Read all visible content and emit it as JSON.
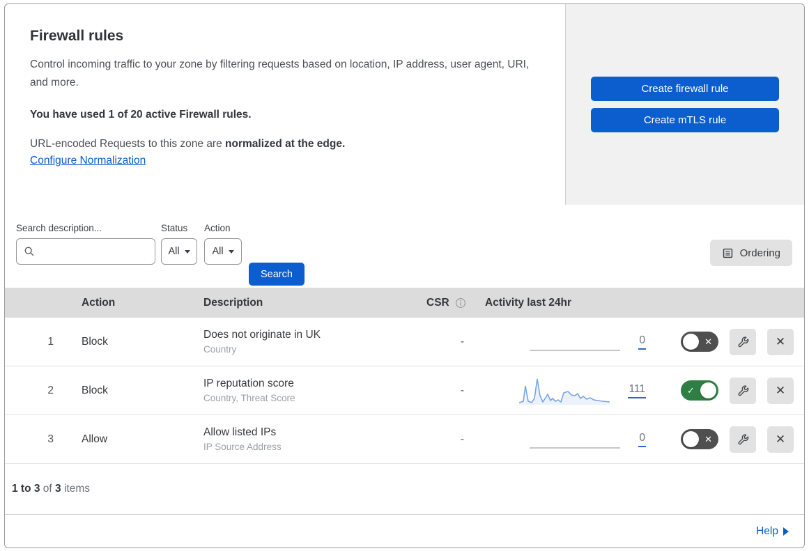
{
  "colors": {
    "accent_blue": "#0c5dce",
    "link_blue": "#0b5cc9",
    "toggle_on_green": "#2d7f43",
    "toggle_off_gray": "#4f4f4f",
    "sparkline_blue": "#7aa5e3",
    "table_header_gray": "#dcdcdc",
    "panel_gray": "#f1f1f2"
  },
  "header": {
    "title": "Firewall rules",
    "description": "Control incoming traffic to your zone by filtering requests based on location, IP address, user agent, URI, and more.",
    "usage_note": "You have used 1 of 20 active Firewall rules.",
    "normalization_prefix": "URL-encoded Requests to this zone are ",
    "normalization_bold": "normalized at the edge.",
    "normalization_link": "Configure Normalization"
  },
  "actions_panel": {
    "create_firewall_rule_label": "Create firewall rule",
    "create_mtls_rule_label": "Create mTLS rule"
  },
  "filters": {
    "search_label": "Search description...",
    "status_label": "Status",
    "status_value": "All",
    "action_label": "Action",
    "action_value": "All",
    "search_button_label": "Search",
    "ordering_button_label": "Ordering"
  },
  "table": {
    "columns": {
      "action": "Action",
      "description": "Description",
      "csr": "CSR",
      "activity": "Activity last 24hr"
    },
    "rows": [
      {
        "number": "1",
        "action": "Block",
        "description": "Does not originate in UK",
        "fields": "Country",
        "csr": "-",
        "activity_count": "0",
        "enabled": false,
        "has_activity": false
      },
      {
        "number": "2",
        "action": "Block",
        "description": "IP reputation score",
        "fields": "Country, Threat Score",
        "csr": "-",
        "activity_count": "111",
        "enabled": true,
        "has_activity": true
      },
      {
        "number": "3",
        "action": "Allow",
        "description": "Allow listed IPs",
        "fields": "IP Source Address",
        "csr": "-",
        "activity_count": "0",
        "enabled": false,
        "has_activity": false
      }
    ]
  },
  "icons": {
    "toggle_on_glyph": "✓",
    "toggle_off_glyph": "✕",
    "close_glyph": "✕"
  },
  "footer": {
    "range_bold": "1 to 3",
    "of_text": " of ",
    "total_bold": "3",
    "items_text": " items",
    "help_label": "Help"
  }
}
